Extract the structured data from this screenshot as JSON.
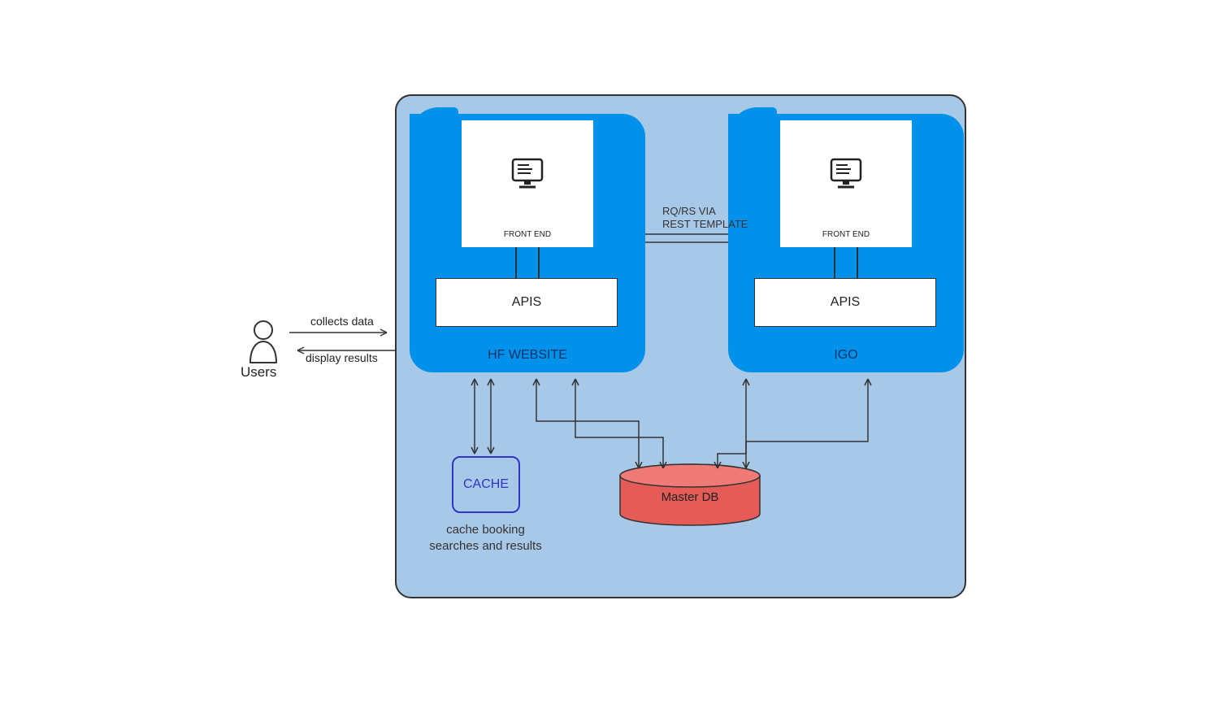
{
  "actors": {
    "users": "Users"
  },
  "edges": {
    "collects": "collects data",
    "display": "display results",
    "rqrs": "RQ/RS VIA\nREST TEMPLATE"
  },
  "system": {
    "modules": [
      {
        "key": "hf",
        "title": "HF WEBSITE",
        "frontend_label": "FRONT END",
        "apis_label": "APIS"
      },
      {
        "key": "igo",
        "title": "IGO",
        "frontend_label": "FRONT END",
        "apis_label": "APIS"
      }
    ],
    "cache": {
      "label": "CACHE",
      "caption": "cache booking searches and results"
    },
    "database": {
      "label": "Master DB"
    }
  },
  "colors": {
    "container_bg": "#a8c8e8",
    "module_bg": "#0091ea",
    "db_fill": "#e55b57",
    "cache_border": "#3333cc"
  }
}
